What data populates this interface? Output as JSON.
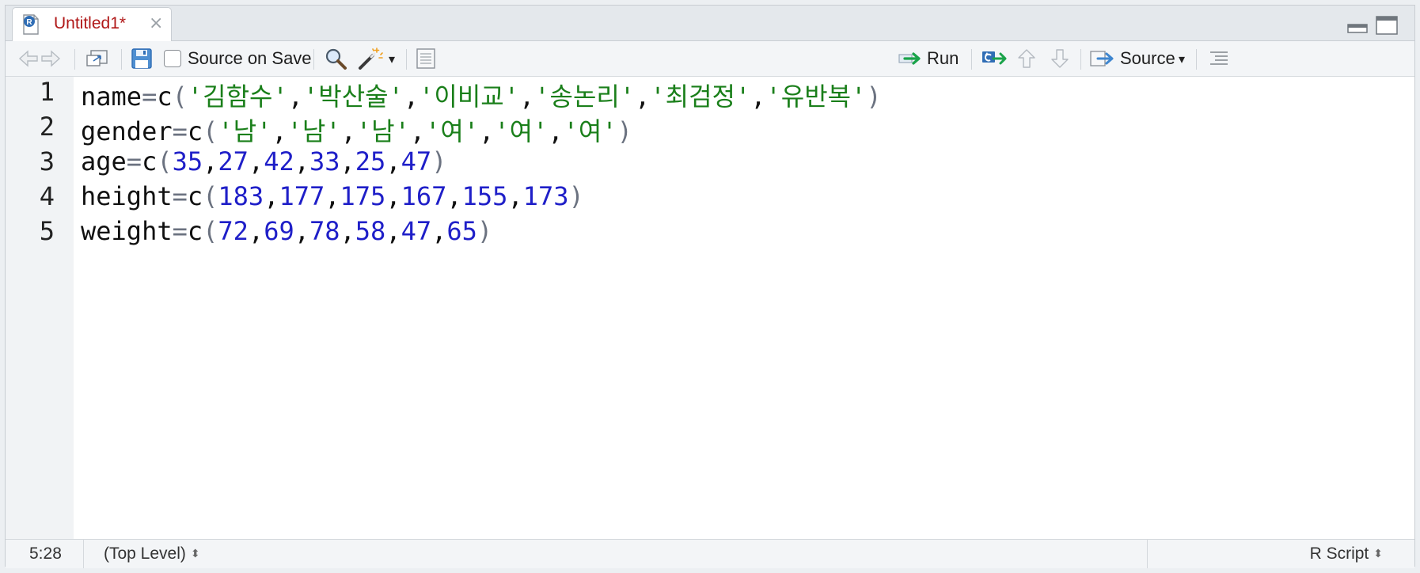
{
  "tab": {
    "title": "Untitled1*",
    "icon": "r-document-icon",
    "close_glyph": "×"
  },
  "toolbar": {
    "source_on_save_label": "Source on Save",
    "source_on_save_checked": false,
    "run_label": "Run",
    "source_label": "Source",
    "dropdown_glyph": "▾"
  },
  "editor": {
    "lines": [
      {
        "num": "1",
        "tokens": [
          {
            "t": "name",
            "k": "id"
          },
          {
            "t": "=",
            "k": "op"
          },
          {
            "t": "c",
            "k": "id"
          },
          {
            "t": "(",
            "k": "paren"
          },
          {
            "t": "'김함수'",
            "k": "str"
          },
          {
            "t": ",",
            "k": "comma"
          },
          {
            "t": "'박산술'",
            "k": "str"
          },
          {
            "t": ",",
            "k": "comma"
          },
          {
            "t": "'이비교'",
            "k": "str"
          },
          {
            "t": ",",
            "k": "comma"
          },
          {
            "t": "'송논리'",
            "k": "str"
          },
          {
            "t": ",",
            "k": "comma"
          },
          {
            "t": "'최검정'",
            "k": "str"
          },
          {
            "t": ",",
            "k": "comma"
          },
          {
            "t": "'유반복'",
            "k": "str"
          },
          {
            "t": ")",
            "k": "paren"
          }
        ]
      },
      {
        "num": "2",
        "tokens": [
          {
            "t": "gender",
            "k": "id"
          },
          {
            "t": "=",
            "k": "op"
          },
          {
            "t": "c",
            "k": "id"
          },
          {
            "t": "(",
            "k": "paren"
          },
          {
            "t": "'남'",
            "k": "str"
          },
          {
            "t": ",",
            "k": "comma"
          },
          {
            "t": "'남'",
            "k": "str"
          },
          {
            "t": ",",
            "k": "comma"
          },
          {
            "t": "'남'",
            "k": "str"
          },
          {
            "t": ",",
            "k": "comma"
          },
          {
            "t": "'여'",
            "k": "str"
          },
          {
            "t": ",",
            "k": "comma"
          },
          {
            "t": "'여'",
            "k": "str"
          },
          {
            "t": ",",
            "k": "comma"
          },
          {
            "t": "'여'",
            "k": "str"
          },
          {
            "t": ")",
            "k": "paren"
          }
        ]
      },
      {
        "num": "3",
        "tokens": [
          {
            "t": "age",
            "k": "id"
          },
          {
            "t": "=",
            "k": "op"
          },
          {
            "t": "c",
            "k": "id"
          },
          {
            "t": "(",
            "k": "paren"
          },
          {
            "t": "35",
            "k": "num"
          },
          {
            "t": ",",
            "k": "comma"
          },
          {
            "t": "27",
            "k": "num"
          },
          {
            "t": ",",
            "k": "comma"
          },
          {
            "t": "42",
            "k": "num"
          },
          {
            "t": ",",
            "k": "comma"
          },
          {
            "t": "33",
            "k": "num"
          },
          {
            "t": ",",
            "k": "comma"
          },
          {
            "t": "25",
            "k": "num"
          },
          {
            "t": ",",
            "k": "comma"
          },
          {
            "t": "47",
            "k": "num"
          },
          {
            "t": ")",
            "k": "paren"
          }
        ]
      },
      {
        "num": "4",
        "tokens": [
          {
            "t": "height",
            "k": "id"
          },
          {
            "t": "=",
            "k": "op"
          },
          {
            "t": "c",
            "k": "id"
          },
          {
            "t": "(",
            "k": "paren"
          },
          {
            "t": "183",
            "k": "num"
          },
          {
            "t": ",",
            "k": "comma"
          },
          {
            "t": "177",
            "k": "num"
          },
          {
            "t": ",",
            "k": "comma"
          },
          {
            "t": "175",
            "k": "num"
          },
          {
            "t": ",",
            "k": "comma"
          },
          {
            "t": "167",
            "k": "num"
          },
          {
            "t": ",",
            "k": "comma"
          },
          {
            "t": "155",
            "k": "num"
          },
          {
            "t": ",",
            "k": "comma"
          },
          {
            "t": "173",
            "k": "num"
          },
          {
            "t": ")",
            "k": "paren"
          }
        ]
      },
      {
        "num": "5",
        "tokens": [
          {
            "t": "weight",
            "k": "id"
          },
          {
            "t": "=",
            "k": "op"
          },
          {
            "t": "c",
            "k": "id"
          },
          {
            "t": "(",
            "k": "paren"
          },
          {
            "t": "72",
            "k": "num"
          },
          {
            "t": ",",
            "k": "comma"
          },
          {
            "t": "69",
            "k": "num"
          },
          {
            "t": ",",
            "k": "comma"
          },
          {
            "t": "78",
            "k": "num"
          },
          {
            "t": ",",
            "k": "comma"
          },
          {
            "t": "58",
            "k": "num"
          },
          {
            "t": ",",
            "k": "comma"
          },
          {
            "t": "47",
            "k": "num"
          },
          {
            "t": ",",
            "k": "comma"
          },
          {
            "t": "65",
            "k": "num"
          },
          {
            "t": ")",
            "k": "paren"
          }
        ]
      }
    ]
  },
  "status": {
    "cursor_position": "5:28",
    "scope": "(Top Level)",
    "file_type": "R Script",
    "updown_glyph": "⬍"
  },
  "colors": {
    "tab_title": "#b01818",
    "string": "#1a7f1a",
    "number": "#1f1fc8",
    "operator": "#6b7280",
    "run_arrow": "#1aa34a"
  }
}
